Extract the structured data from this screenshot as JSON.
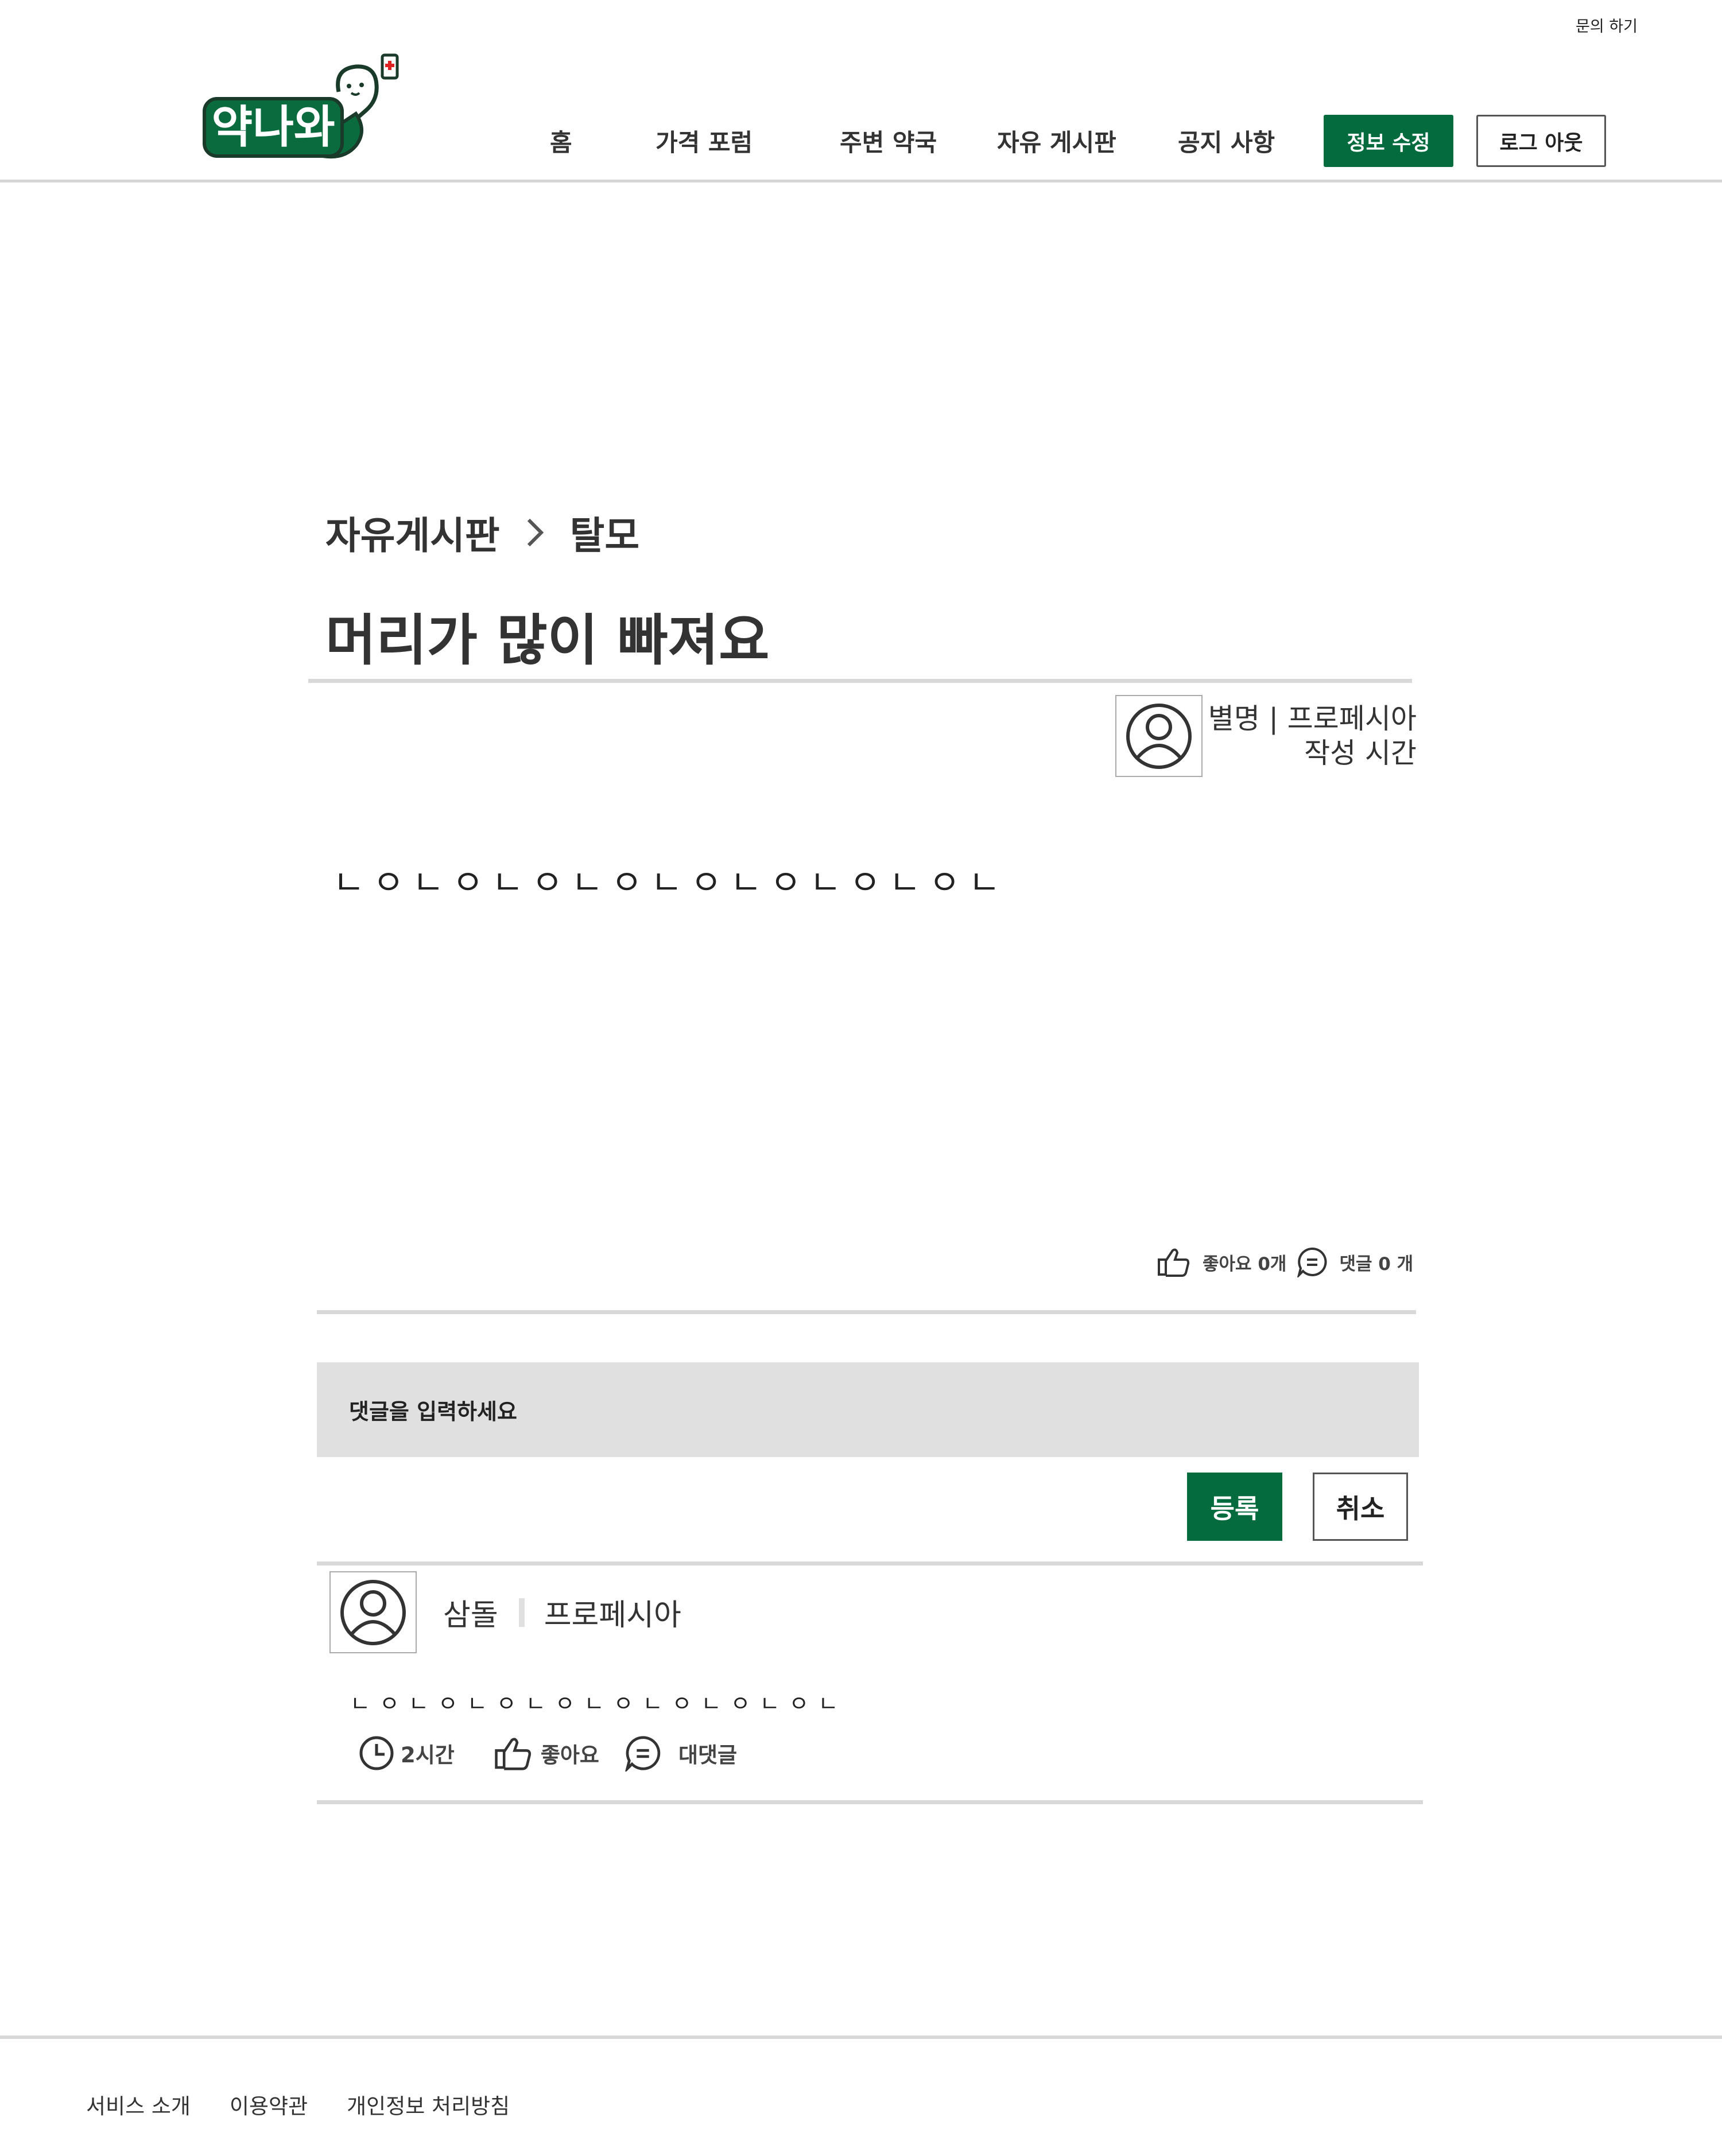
{
  "header": {
    "contact_label": "문의 하기",
    "logo_text": "약나와",
    "nav": {
      "home": "홈",
      "price_forum": "가격 포럼",
      "nearby_pharmacy": "주변 약국",
      "free_board": "자유 게시판",
      "notice": "공지 사항"
    },
    "edit_info_label": "정보 수정",
    "logout_label": "로그 아웃"
  },
  "post": {
    "breadcrumb": {
      "board": "자유게시판",
      "category": "탈모"
    },
    "title": "머리가 많이 빠져요",
    "author": {
      "nickname_line": "별명 | 프로페시아",
      "time_line": "작성 시간"
    },
    "body": "ㄴㅇㄴㅇㄴㅇㄴㅇㄴㅇㄴㅇㄴㅇㄴㅇㄴ",
    "likes_label": "좋아요 0개",
    "comments_label": "댓글 0 개"
  },
  "comment_form": {
    "placeholder": "댓글을 입력하세요",
    "submit_label": "등록",
    "cancel_label": "취소"
  },
  "comments": [
    {
      "author": "삼돌",
      "tag": "프로페시아",
      "body": "ㄴㅇㄴㅇㄴㅇㄴㅇㄴㅇㄴㅇㄴㅇㄴㅇㄴ",
      "time": "2시간",
      "like_label": "좋아요",
      "reply_label": "대댓글"
    }
  ],
  "footer": {
    "links": [
      "서비스 소개",
      "이용약관",
      "개인정보 처리방침"
    ]
  },
  "colors": {
    "brand_green": "#046b3f",
    "divider": "#d8d8d8",
    "input_bg": "#e0e0e0"
  }
}
